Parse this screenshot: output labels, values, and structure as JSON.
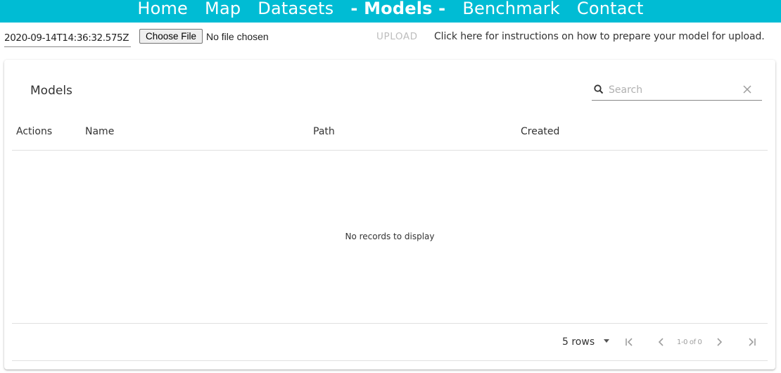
{
  "nav": {
    "items": [
      {
        "label": "Home"
      },
      {
        "label": "Map"
      },
      {
        "label": "Datasets"
      },
      {
        "label": "- Models -"
      },
      {
        "label": "Benchmark"
      },
      {
        "label": "Contact"
      }
    ],
    "active_index": 3,
    "bg_color": "#00bcd4"
  },
  "upload": {
    "date_value": "2020-09-14T14:36:32.575Z",
    "choose_file_label": "Choose File",
    "no_file_text": "No file chosen",
    "upload_label": "UPLOAD",
    "instructions_text": "Click here for instructions on how to prepare your model for upload."
  },
  "table": {
    "title": "Models",
    "search_placeholder": "Search",
    "columns": [
      "Actions",
      "Name",
      "Path",
      "Created"
    ],
    "empty_text": "No records to display",
    "rows_per_page": "5 rows",
    "page_count": "1-0 of 0"
  },
  "icons": {
    "search": "search-icon",
    "clear": "close-icon",
    "dropdown": "caret-down-icon",
    "first": "first-page-icon",
    "prev": "chevron-left-icon",
    "next": "chevron-right-icon",
    "last": "last-page-icon"
  }
}
